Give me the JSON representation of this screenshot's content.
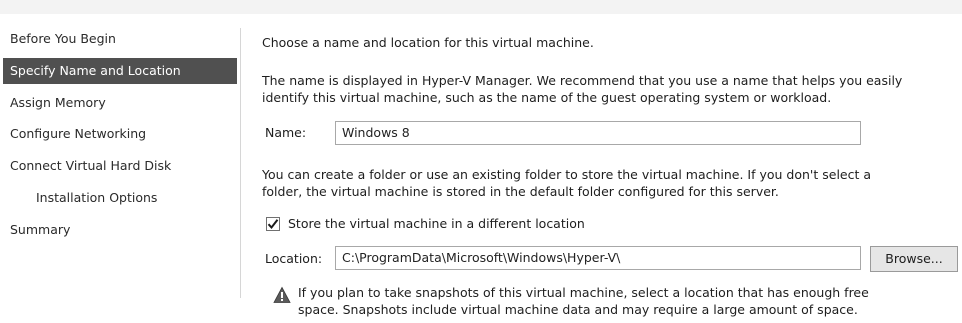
{
  "sidebar": {
    "items": [
      {
        "label": "Before You Begin",
        "selected": false,
        "sub": false
      },
      {
        "label": "Specify Name and Location",
        "selected": true,
        "sub": false
      },
      {
        "label": "Assign Memory",
        "selected": false,
        "sub": false
      },
      {
        "label": "Configure Networking",
        "selected": false,
        "sub": false
      },
      {
        "label": "Connect Virtual Hard Disk",
        "selected": false,
        "sub": false
      },
      {
        "label": "Installation Options",
        "selected": false,
        "sub": true
      },
      {
        "label": "Summary",
        "selected": false,
        "sub": false
      }
    ]
  },
  "main": {
    "heading": "Choose a name and location for this virtual machine.",
    "intro_line1": "The name is displayed in Hyper-V Manager. We recommend that you use a name that helps you easily",
    "intro_line2": "identify this virtual machine, such as the name of the guest operating system or workload.",
    "name_label": "Name:",
    "name_value": "Windows 8",
    "folder_line1": "You can create a folder or use an existing folder to store the virtual machine. If you don't select a",
    "folder_line2": "folder, the virtual machine is stored in the default folder configured for this server.",
    "store_checkbox_label": "Store the virtual machine in a different location",
    "store_checkbox_checked": true,
    "location_label": "Location:",
    "location_value": "C:\\ProgramData\\Microsoft\\Windows\\Hyper-V\\",
    "browse_label": "Browse...",
    "warning_line1": "If you plan to take snapshots of this virtual machine, select a location that has enough free",
    "warning_line2": "space. Snapshots include virtual machine data and may require a large amount of space.",
    "warning_icon": "warning-icon"
  }
}
